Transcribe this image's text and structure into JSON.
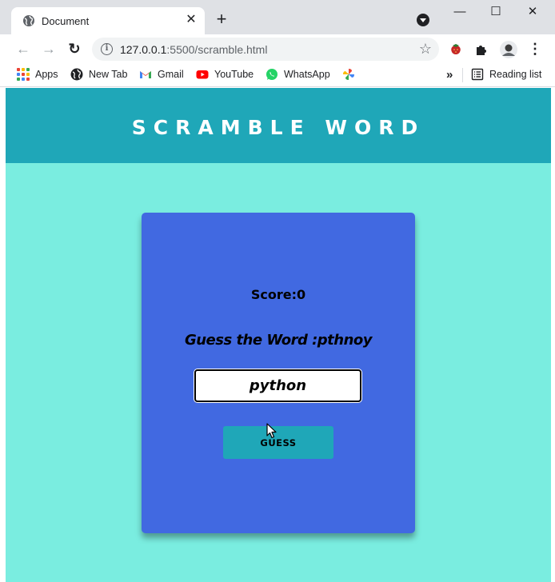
{
  "browser": {
    "tab": {
      "title": "Document",
      "close_glyph": "✕",
      "icon": "globe-icon"
    },
    "new_tab_glyph": "+",
    "window_controls": {
      "minimize": "—",
      "maximize": "☐",
      "close": "✕"
    },
    "toolbar": {
      "back_glyph": "←",
      "forward_glyph": "→",
      "reload_glyph": "↻",
      "url_host": "127.0.0.1",
      "url_rest": ":5500/scramble.html",
      "info_glyph": "i",
      "star_glyph": "☆",
      "menu_glyph": "⋮"
    },
    "bookmarks": [
      {
        "label": "Apps",
        "icon": "apps-grid-icon"
      },
      {
        "label": "New Tab",
        "icon": "globe-icon"
      },
      {
        "label": "Gmail",
        "icon": "gmail-icon"
      },
      {
        "label": "YouTube",
        "icon": "youtube-icon"
      },
      {
        "label": "WhatsApp",
        "icon": "whatsapp-icon"
      },
      {
        "label": "",
        "icon": "photos-pinwheel-icon"
      }
    ],
    "overflow_glyph": "»",
    "reading_list": {
      "label": "Reading list",
      "icon": "reading-list-icon"
    }
  },
  "app": {
    "title": "Scramble Word",
    "score_label": "Score:0",
    "prompt": "Guess the Word :pthnoy",
    "input_value": "python",
    "button_label": "Guess"
  },
  "colors": {
    "header_bg": "#1fa7b8",
    "page_bg": "#7aede0",
    "card_bg": "#4169e1",
    "button_bg": "#1fa7b8",
    "tabstrip_bg": "#dfe1e5"
  }
}
